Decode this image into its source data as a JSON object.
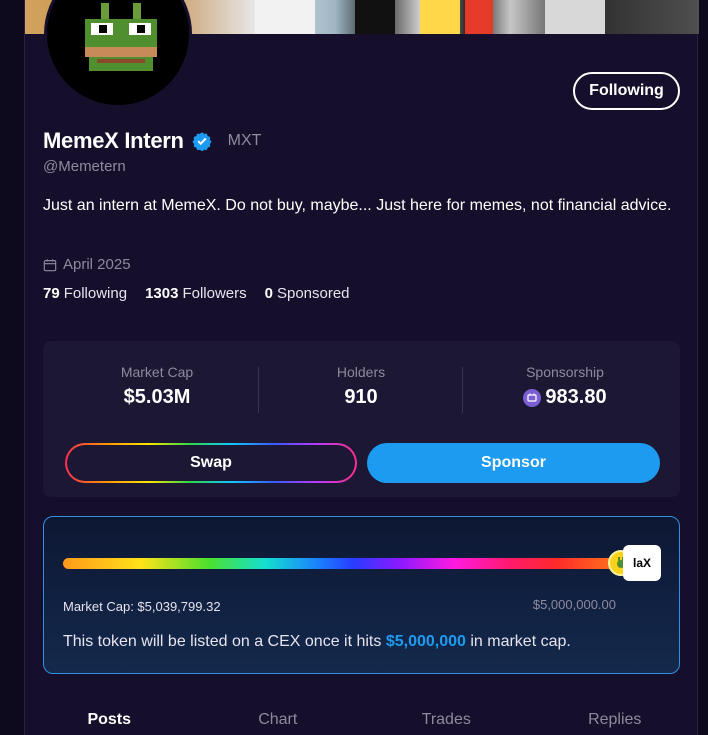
{
  "profile": {
    "name": "MemeX Intern",
    "ticker": "MXT",
    "handle": "@Memetern",
    "bio": "Just an intern at MemeX. Do not buy, maybe... Just here for memes, not financial advice.",
    "joined": "April 2025",
    "follow_label": "Following"
  },
  "stats": {
    "following_count": "79",
    "following_label": "Following",
    "followers_count": "1303",
    "followers_label": "Followers",
    "sponsored_count": "0",
    "sponsored_label": "Sponsored"
  },
  "market": {
    "market_cap_label": "Market Cap",
    "market_cap_value": "$5.03M",
    "holders_label": "Holders",
    "holders_value": "910",
    "sponsorship_label": "Sponsorship",
    "sponsorship_value": "983.80",
    "swap_label": "Swap",
    "sponsor_label": "Sponsor"
  },
  "progress": {
    "fill_fraction": 1.0,
    "current_label": "Market Cap: $5,039,799.32",
    "target_label": "$5,000,000.00",
    "cex_logo_text": "laX",
    "note_prefix": "This token will be listed on a CEX once it hits ",
    "note_amount": "$5,000,000",
    "note_suffix": " in market cap."
  },
  "tabs": [
    "Posts",
    "Chart",
    "Trades",
    "Replies"
  ],
  "colors": {
    "accent": "#1d9bf0",
    "verified": "#1d9bf0",
    "background": "#150f2b"
  },
  "icons": {
    "verified": "verified-badge-icon",
    "calendar": "calendar-icon",
    "coin": "sponsor-coin-icon"
  }
}
